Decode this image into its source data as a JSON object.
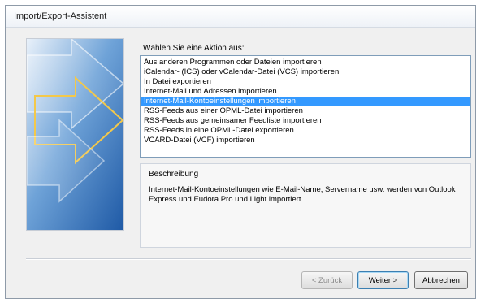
{
  "window": {
    "title": "Import/Export-Assistent"
  },
  "action_list": {
    "prompt": "Wählen Sie eine Aktion aus:",
    "items": [
      "Aus anderen Programmen oder Dateien importieren",
      "iCalendar- (ICS) oder vCalendar-Datei (VCS) importieren",
      "In Datei exportieren",
      "Internet-Mail und Adressen importieren",
      "Internet-Mail-Kontoeinstellungen importieren",
      "RSS-Feeds aus einer OPML-Datei importieren",
      "RSS-Feeds aus gemeinsamer Feedliste importieren",
      "RSS-Feeds in eine OPML-Datei exportieren",
      "VCARD-Datei (VCF) importieren"
    ],
    "selected_index": 4
  },
  "description": {
    "title": "Beschreibung",
    "text": "Internet-Mail-Kontoeinstellungen wie E-Mail-Name, Servername usw. werden von Outlook Express und Eudora Pro und Light importiert."
  },
  "buttons": {
    "back": "< Zurück",
    "next": "Weiter >",
    "cancel": "Abbrechen"
  },
  "colors": {
    "selection": "#3399ff",
    "art_blue": "#2f6fb5"
  }
}
